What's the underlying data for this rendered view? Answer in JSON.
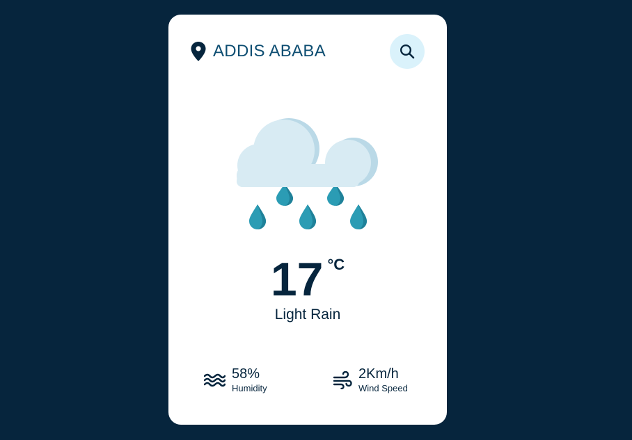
{
  "header": {
    "city": "ADDIS ABABA",
    "location_icon": "location-pin-icon",
    "search_icon": "search-icon"
  },
  "weather": {
    "icon": "cloud-rain-icon",
    "temperature": "17",
    "unit": "°C",
    "condition": "Light Rain"
  },
  "details": {
    "humidity": {
      "value": "58%",
      "label": "Humidity",
      "icon": "humidity-waves-icon"
    },
    "wind": {
      "value": "2Km/h",
      "label": "Wind Speed",
      "icon": "wind-icon"
    }
  },
  "colors": {
    "background": "#06253d",
    "card": "#ffffff",
    "city_text": "#0e4e72",
    "search_bg": "#daf2fb",
    "cloud": "#d8ebf3",
    "cloud_shadow": "#bad9e7",
    "raindrop": "#2b9cb4"
  }
}
